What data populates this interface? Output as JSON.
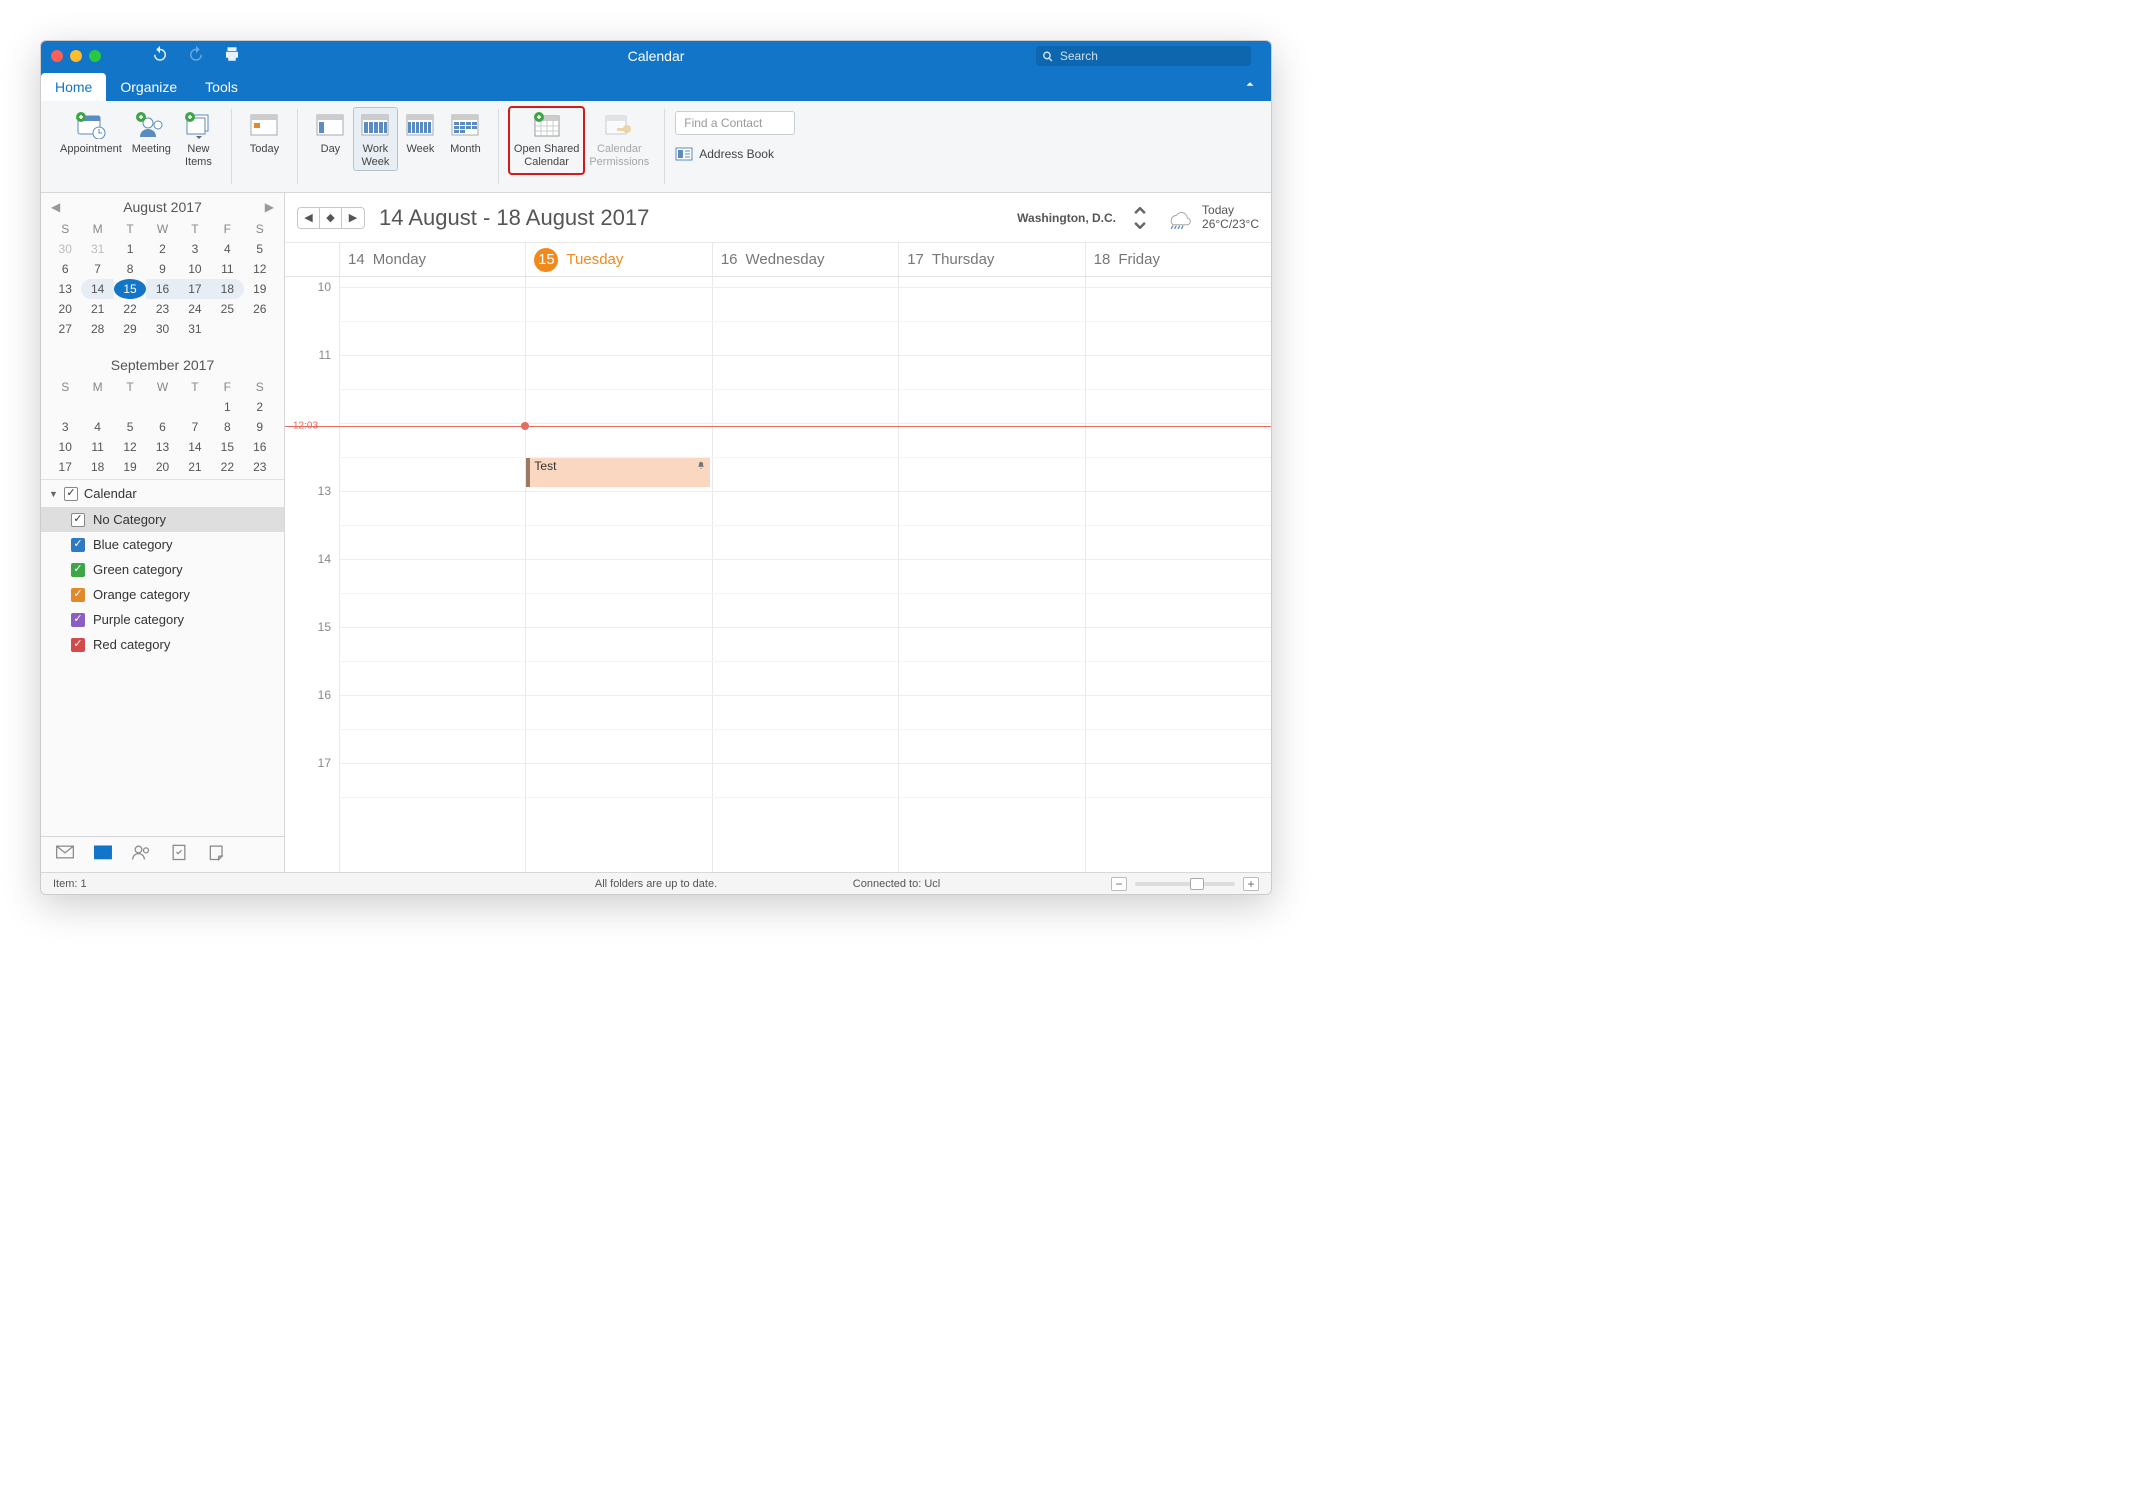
{
  "title": "Calendar",
  "search_placeholder": "Search",
  "tabs": {
    "home": "Home",
    "organize": "Organize",
    "tools": "Tools"
  },
  "ribbon": {
    "appointment": "Appointment",
    "meeting": "Meeting",
    "new_items": "New\nItems",
    "today": "Today",
    "day": "Day",
    "work_week": "Work\nWeek",
    "week": "Week",
    "month": "Month",
    "open_shared": "Open Shared\nCalendar",
    "permissions": "Calendar\nPermissions",
    "find_contact": "Find a Contact",
    "address_book": "Address Book"
  },
  "mini1": {
    "title": "August 2017",
    "dow": [
      "S",
      "M",
      "T",
      "W",
      "T",
      "F",
      "S"
    ],
    "rows": [
      [
        {
          "d": 30,
          "o": true
        },
        {
          "d": 31,
          "o": true
        },
        {
          "d": 1
        },
        {
          "d": 2
        },
        {
          "d": 3
        },
        {
          "d": 4
        },
        {
          "d": 5
        }
      ],
      [
        {
          "d": 6
        },
        {
          "d": 7
        },
        {
          "d": 8
        },
        {
          "d": 9
        },
        {
          "d": 10
        },
        {
          "d": 11
        },
        {
          "d": 12
        }
      ],
      [
        {
          "d": 13
        },
        {
          "d": 14,
          "wk": "first"
        },
        {
          "d": 15,
          "sel": true
        },
        {
          "d": 16,
          "wk": true
        },
        {
          "d": 17,
          "wk": true
        },
        {
          "d": 18,
          "wk": "last"
        },
        {
          "d": 19
        }
      ],
      [
        {
          "d": 20
        },
        {
          "d": 21
        },
        {
          "d": 22
        },
        {
          "d": 23
        },
        {
          "d": 24
        },
        {
          "d": 25
        },
        {
          "d": 26
        }
      ],
      [
        {
          "d": 27
        },
        {
          "d": 28
        },
        {
          "d": 29
        },
        {
          "d": 30
        },
        {
          "d": 31
        },
        {
          "d": "",
          "o": true
        },
        {
          "d": "",
          "o": true
        }
      ]
    ]
  },
  "mini2": {
    "title": "September 2017",
    "dow": [
      "S",
      "M",
      "T",
      "W",
      "T",
      "F",
      "S"
    ],
    "rows": [
      [
        {
          "d": "",
          "o": true
        },
        {
          "d": "",
          "o": true
        },
        {
          "d": "",
          "o": true
        },
        {
          "d": "",
          "o": true
        },
        {
          "d": "",
          "o": true
        },
        {
          "d": 1
        },
        {
          "d": 2
        }
      ],
      [
        {
          "d": 3
        },
        {
          "d": 4
        },
        {
          "d": 5
        },
        {
          "d": 6
        },
        {
          "d": 7
        },
        {
          "d": 8
        },
        {
          "d": 9
        }
      ],
      [
        {
          "d": 10
        },
        {
          "d": 11
        },
        {
          "d": 12
        },
        {
          "d": 13
        },
        {
          "d": 14
        },
        {
          "d": 15
        },
        {
          "d": 16
        }
      ],
      [
        {
          "d": 17
        },
        {
          "d": 18
        },
        {
          "d": 19
        },
        {
          "d": 20
        },
        {
          "d": 21
        },
        {
          "d": 22
        },
        {
          "d": 23
        }
      ]
    ]
  },
  "calroot": "Calendar",
  "categories": [
    {
      "label": "No Category",
      "color": "#ffffff",
      "selected": true
    },
    {
      "label": "Blue category",
      "color": "#2e79c4"
    },
    {
      "label": "Green category",
      "color": "#3fa648"
    },
    {
      "label": "Orange category",
      "color": "#e28a2b"
    },
    {
      "label": "Purple category",
      "color": "#8a5fc1"
    },
    {
      "label": "Red category",
      "color": "#d24a4a"
    }
  ],
  "range": "14 August - 18 August 2017",
  "weather": {
    "location": "Washington,  D.C.",
    "today_label": "Today",
    "temps": "26°C/23°C"
  },
  "days": [
    {
      "num": "14",
      "name": "Monday"
    },
    {
      "num": "15",
      "name": "Tuesday",
      "today": true
    },
    {
      "num": "16",
      "name": "Wednesday"
    },
    {
      "num": "17",
      "name": "Thursday"
    },
    {
      "num": "18",
      "name": "Friday"
    }
  ],
  "hours": [
    "10",
    "11",
    "",
    "13",
    "14",
    "15",
    "16",
    "17"
  ],
  "now": "12:03",
  "event": {
    "title": "Test"
  },
  "status": {
    "item": "Item: 1",
    "sync": "All folders are up to date.",
    "conn": "Connected to: Ucl"
  }
}
